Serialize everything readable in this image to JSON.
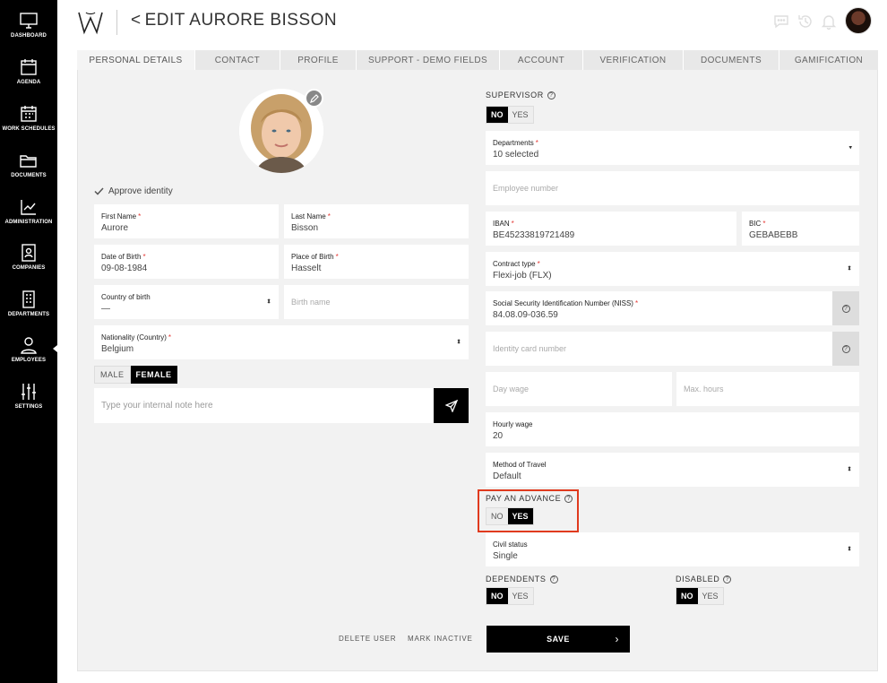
{
  "sidebar": {
    "items": [
      {
        "label": "DASHBOARD",
        "icon": "monitor-icon"
      },
      {
        "label": "AGENDA",
        "icon": "calendar-icon"
      },
      {
        "label": "WORK SCHEDULES",
        "icon": "schedule-grid-icon"
      },
      {
        "label": "DOCUMENTS",
        "icon": "folder-icon"
      },
      {
        "label": "ADMINISTRATION",
        "icon": "chart-up-icon"
      },
      {
        "label": "COMPANIES",
        "icon": "contact-card-icon"
      },
      {
        "label": "DEPARTMENTS",
        "icon": "building-icon"
      },
      {
        "label": "EMPLOYEES",
        "icon": "user-icon"
      },
      {
        "label": "SETTINGS",
        "icon": "sliders-icon"
      }
    ]
  },
  "header": {
    "back_glyph": "<",
    "title": "EDIT AURORE BISSON"
  },
  "tabs": [
    {
      "label": "PERSONAL DETAILS",
      "active": true
    },
    {
      "label": "CONTACT"
    },
    {
      "label": "PROFILE"
    },
    {
      "label": "SUPPORT - DEMO FIELDS"
    },
    {
      "label": "ACCOUNT"
    },
    {
      "label": "VERIFICATION"
    },
    {
      "label": "DOCUMENTS"
    },
    {
      "label": "GAMIFICATION"
    }
  ],
  "left": {
    "approve_identity": "Approve identity",
    "first_name": {
      "label": "First Name",
      "value": "Aurore"
    },
    "last_name": {
      "label": "Last Name",
      "value": "Bisson"
    },
    "date_of_birth": {
      "label": "Date of Birth",
      "value": "09-08-1984"
    },
    "place_of_birth": {
      "label": "Place of Birth",
      "value": "Hasselt"
    },
    "country_of_birth": {
      "label": "Country of birth",
      "value": "—"
    },
    "birth_name": {
      "placeholder": "Birth name"
    },
    "nationality": {
      "label": "Nationality (Country)",
      "value": "Belgium"
    },
    "gender": {
      "male": "MALE",
      "female": "FEMALE",
      "selected": "FEMALE"
    },
    "note_placeholder": "Type your internal note here"
  },
  "right": {
    "supervisor": {
      "label": "SUPERVISOR",
      "no": "NO",
      "yes": "YES",
      "selected": "NO"
    },
    "departments": {
      "label": "Departments",
      "value": "10 selected"
    },
    "employee_number": {
      "placeholder": "Employee number"
    },
    "iban": {
      "label": "IBAN",
      "value": "BE45233819721489"
    },
    "bic": {
      "label": "BIC",
      "value": "GEBABEBB"
    },
    "contract_type": {
      "label": "Contract type",
      "value": "Flexi-job (FLX)"
    },
    "niss": {
      "label": "Social Security Identification Number (NISS)",
      "value": "84.08.09-036.59"
    },
    "identity_card": {
      "placeholder": "Identity card number"
    },
    "day_wage": {
      "placeholder": "Day wage"
    },
    "max_hours": {
      "placeholder": "Max. hours"
    },
    "hourly_wage": {
      "label": "Hourly wage",
      "value": "20"
    },
    "method_of_travel": {
      "label": "Method of Travel",
      "value": "Default"
    },
    "pay_advance": {
      "label": "PAY AN ADVANCE",
      "no": "NO",
      "yes": "YES",
      "selected": "YES"
    },
    "civil_status": {
      "label": "Civil status",
      "value": "Single"
    },
    "dependents": {
      "label": "DEPENDENTS",
      "no": "NO",
      "yes": "YES",
      "selected": "NO"
    },
    "disabled": {
      "label": "DISABLED",
      "no": "NO",
      "yes": "YES",
      "selected": "NO"
    }
  },
  "footer": {
    "delete_user": "DELETE USER",
    "mark_inactive": "MARK INACTIVE",
    "save": "SAVE"
  },
  "colors": {
    "sidebar_bg": "#000000",
    "highlight": "#e03a1e",
    "required": "#e53935"
  }
}
